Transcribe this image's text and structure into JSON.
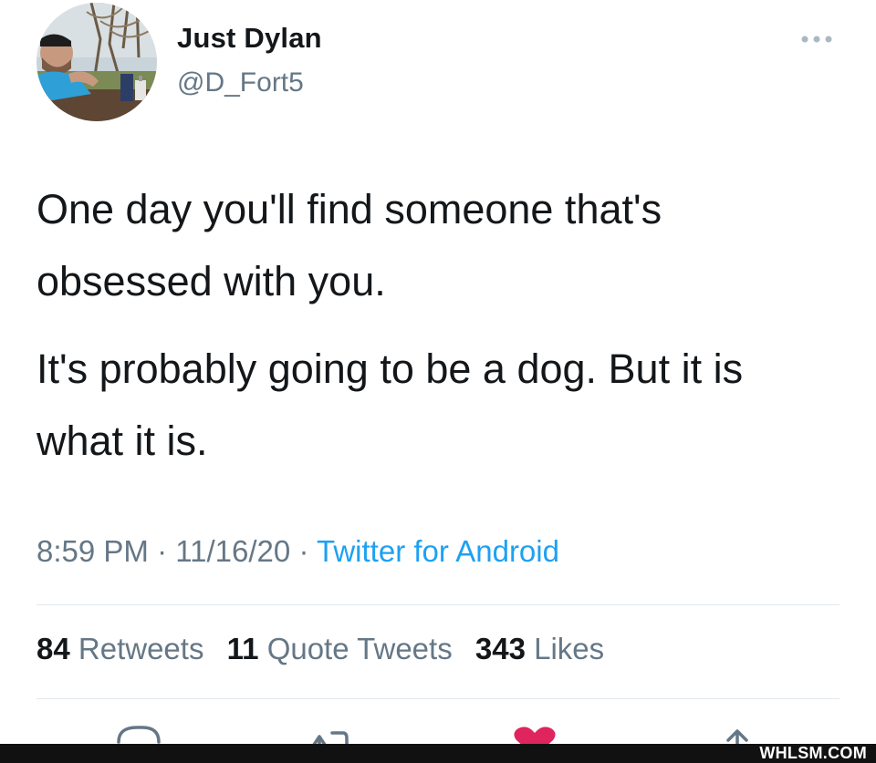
{
  "author": {
    "name": "Just Dylan",
    "handle": "@D_Fort5"
  },
  "tweet": {
    "paragraphs": [
      "One day you'll find someone that's obsessed with you.",
      "It's probably going to be a dog. But it is what it is."
    ],
    "time": "8:59 PM",
    "separator": "·",
    "date": "11/16/20",
    "source": "Twitter for Android"
  },
  "stats": {
    "retweets_count": "84",
    "retweets_label": "Retweets",
    "quotes_count": "11",
    "quotes_label": "Quote Tweets",
    "likes_count": "343",
    "likes_label": "Likes"
  },
  "actions": {
    "icons": [
      "reply-icon",
      "retweet-icon",
      "like-icon",
      "share-icon"
    ]
  },
  "watermark": "WHLSM.COM",
  "colors": {
    "text": "#14171a",
    "secondary": "#657786",
    "link": "#1da1f2",
    "like": "#e0245e",
    "divider": "#e1e8ed"
  }
}
